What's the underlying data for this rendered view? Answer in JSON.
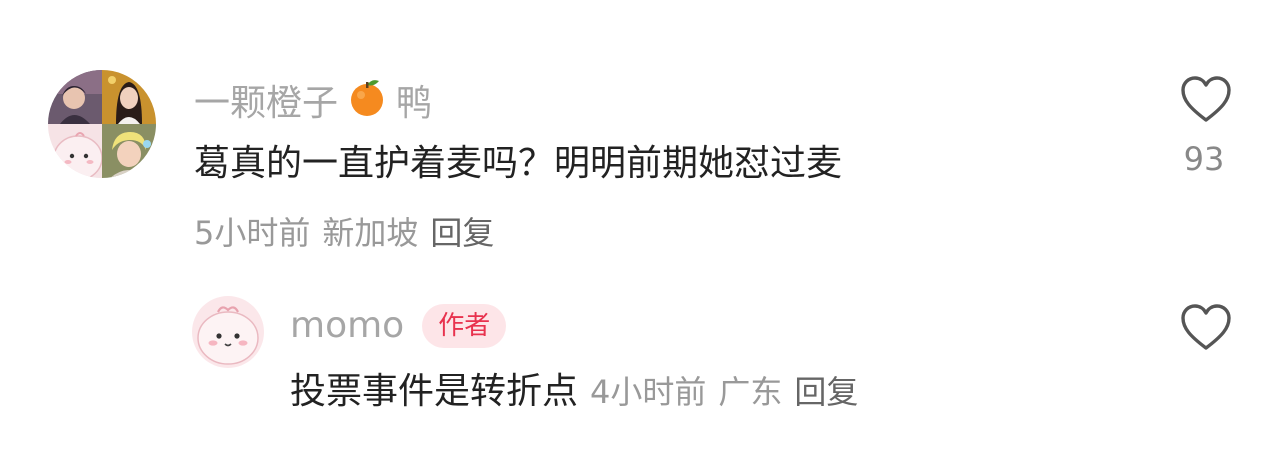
{
  "comment": {
    "username": "一颗橙子",
    "username_suffix": "鸭",
    "username_emoji": "orange-emoji",
    "text": "葛真的一直护着麦吗？明明前期她怼过麦",
    "time": "5小时前",
    "location": "新加坡",
    "reply_label": "回复",
    "like_count": "93",
    "like_icon": "heart-outline-icon"
  },
  "reply": {
    "username": "momo",
    "badge": "作者",
    "text": "投票事件是转折点",
    "time": "4小时前",
    "location": "广东",
    "reply_label": "回复",
    "like_icon": "heart-outline-icon"
  },
  "colors": {
    "username": "#a6a6a6",
    "text": "#222222",
    "meta": "#999999",
    "badge_bg": "#fde5e8",
    "badge_text": "#e8324e"
  }
}
